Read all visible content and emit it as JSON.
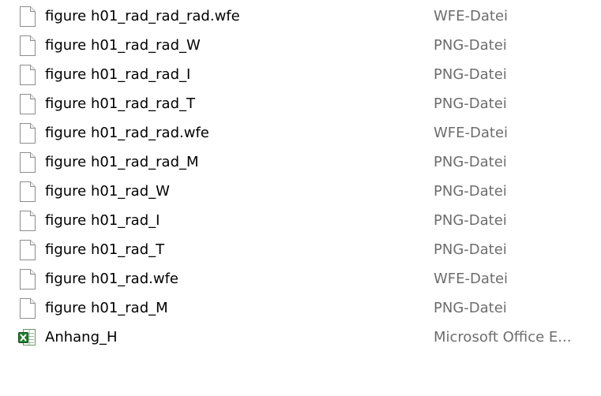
{
  "colors": {
    "name_text": "#000000",
    "type_text": "#6d6d6d",
    "background": "#ffffff"
  },
  "files": [
    {
      "name": "figure h01_rad_rad_rad.wfe",
      "type": "WFE-Datei",
      "icon": "generic-file-icon"
    },
    {
      "name": "figure h01_rad_rad_W",
      "type": "PNG-Datei",
      "icon": "generic-file-icon"
    },
    {
      "name": "figure h01_rad_rad_I",
      "type": "PNG-Datei",
      "icon": "generic-file-icon"
    },
    {
      "name": "figure h01_rad_rad_T",
      "type": "PNG-Datei",
      "icon": "generic-file-icon"
    },
    {
      "name": "figure h01_rad_rad.wfe",
      "type": "WFE-Datei",
      "icon": "generic-file-icon"
    },
    {
      "name": "figure h01_rad_rad_M",
      "type": "PNG-Datei",
      "icon": "generic-file-icon"
    },
    {
      "name": "figure h01_rad_W",
      "type": "PNG-Datei",
      "icon": "generic-file-icon"
    },
    {
      "name": "figure h01_rad_I",
      "type": "PNG-Datei",
      "icon": "generic-file-icon"
    },
    {
      "name": "figure h01_rad_T",
      "type": "PNG-Datei",
      "icon": "generic-file-icon"
    },
    {
      "name": "figure h01_rad.wfe",
      "type": "WFE-Datei",
      "icon": "generic-file-icon"
    },
    {
      "name": "figure h01_rad_M",
      "type": "PNG-Datei",
      "icon": "generic-file-icon"
    },
    {
      "name": "Anhang_H",
      "type": "Microsoft Office E...",
      "icon": "excel-file-icon"
    }
  ]
}
